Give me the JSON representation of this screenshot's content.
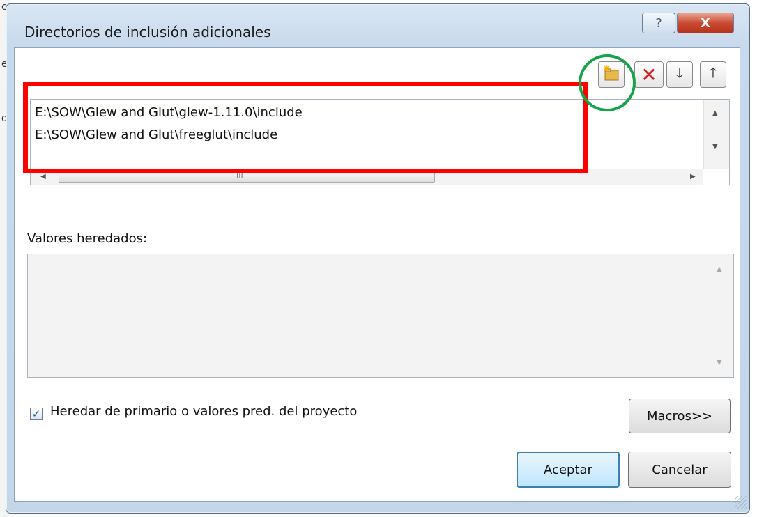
{
  "background": {
    "fragments": [
      "c",
      "e",
      "d",
      "c"
    ]
  },
  "window": {
    "title": "Directorios de inclusión adicionales",
    "help_label": "?",
    "close_label": "X"
  },
  "toolbar": {
    "new_folder_icon": "new-folder-icon",
    "delete_icon": "✕",
    "move_down_icon": "🡓",
    "move_up_icon": "🡑"
  },
  "directories": [
    "E:\\SOW\\Glew and Glut\\glew-1.11.0\\include",
    "E:\\SOW\\Glew and Glut\\freeglut\\include"
  ],
  "scroll": {
    "hscroll_grip": "III"
  },
  "inherited": {
    "label": "Valores heredados:"
  },
  "inherit_option": {
    "label": "Heredar de primario o valores pred. del proyecto",
    "checked": true,
    "check_mark": "✓"
  },
  "buttons": {
    "macros": "Macros>>",
    "accept": "Aceptar",
    "cancel": "Cancelar"
  },
  "colors": {
    "highlight_rect": "#ff0000",
    "highlight_circle": "#16a34a"
  }
}
